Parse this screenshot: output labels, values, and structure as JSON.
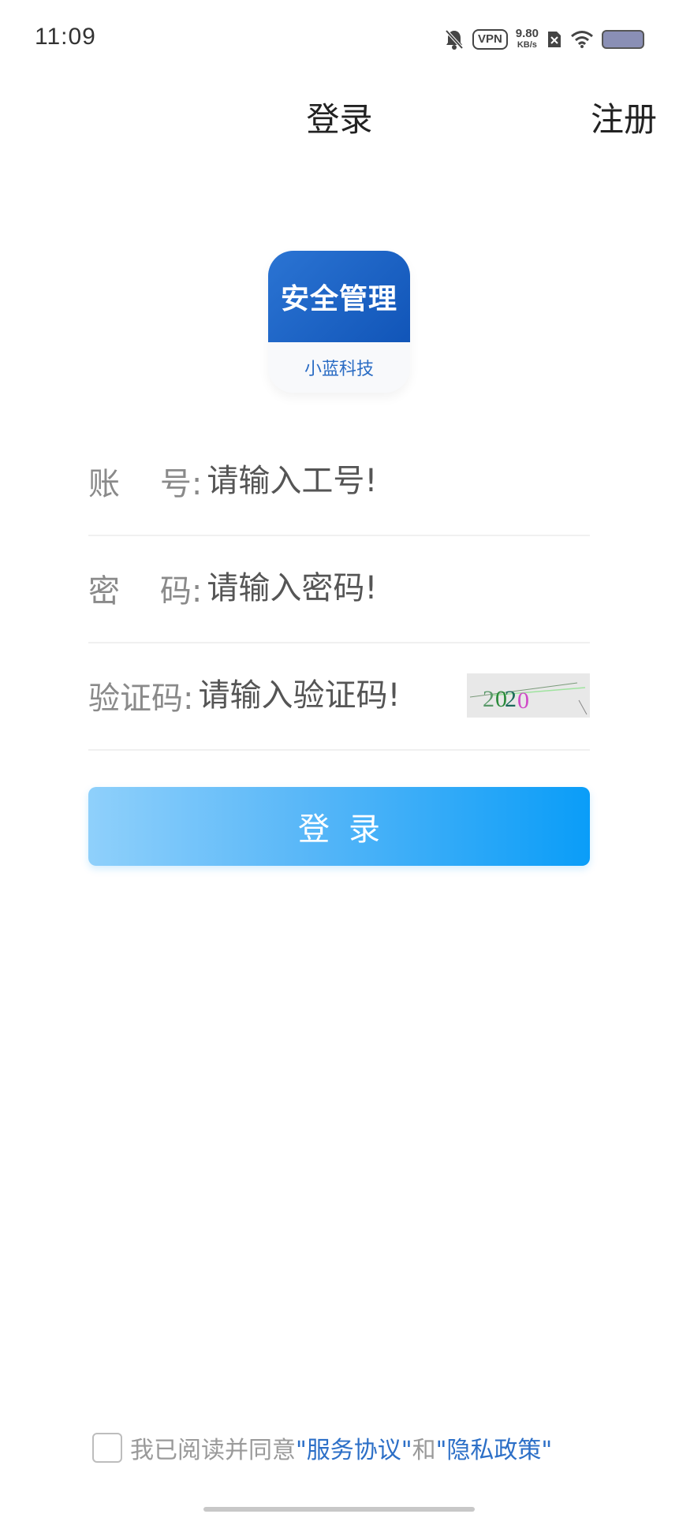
{
  "status_bar": {
    "time": "11:09",
    "vpn_label": "VPN",
    "net_speed_value": "9.80",
    "net_speed_unit": "KB/s",
    "icons": [
      "bell-muted-icon",
      "vpn-icon",
      "no-sim-icon",
      "wifi-icon",
      "battery-icon"
    ]
  },
  "header": {
    "title": "登录",
    "register_label": "注册"
  },
  "logo": {
    "title": "安全管理",
    "subtitle": "小蓝科技",
    "accent_color": "#1a5fc4"
  },
  "form": {
    "account": {
      "label": "账    号:",
      "placeholder": "请输入工号!"
    },
    "password": {
      "label": "密    码:",
      "placeholder": "请输入密码!"
    },
    "captcha": {
      "label": "验证码:",
      "placeholder": "请输入验证码!",
      "image_text": "2020"
    }
  },
  "login_button": {
    "label": "登录",
    "color": "#0a9df8"
  },
  "agreement": {
    "prefix": "我已阅读并同意",
    "service_link": "\"服务协议\"",
    "conjunction": "和",
    "privacy_link": "\"隐私政策\"",
    "link_color": "#2c6fc7",
    "checked": false
  }
}
